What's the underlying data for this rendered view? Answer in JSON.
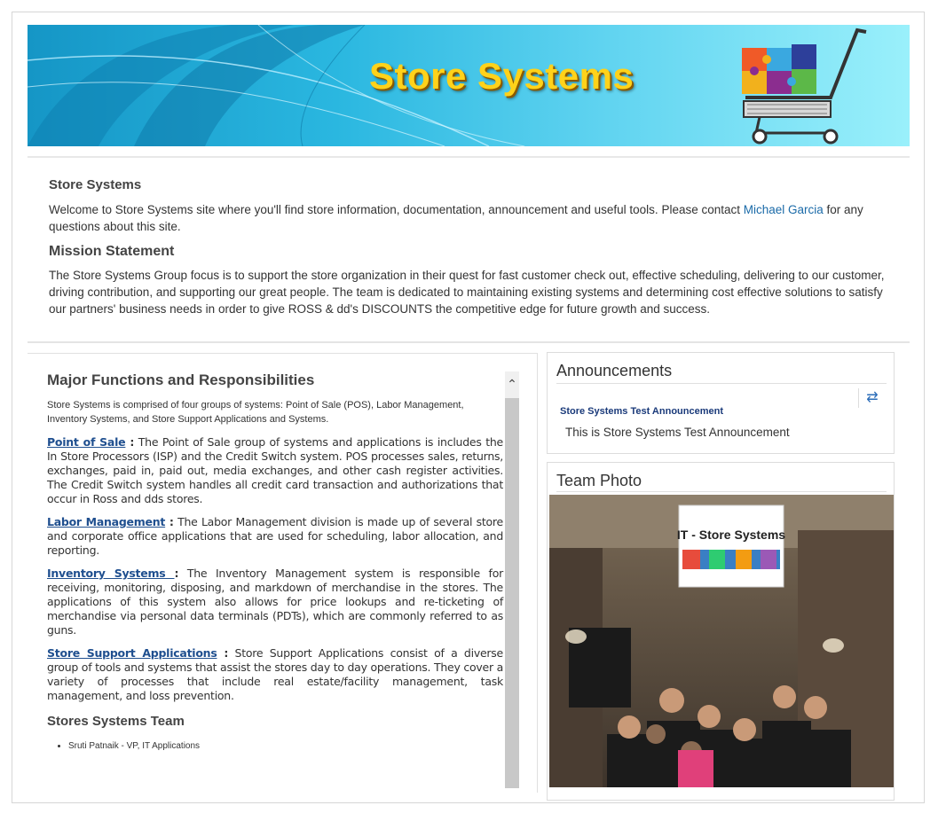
{
  "banner": {
    "title": "Store Systems"
  },
  "intro": {
    "heading": "Store Systems",
    "welcome_before": "Welcome to Store Systems site where you'll find store information, documentation, announcement and useful tools. Please contact ",
    "contact_name": "Michael Garcia",
    "welcome_after": " for any questions about this site."
  },
  "mission": {
    "heading": "Mission Statement",
    "text": "The Store Systems Group focus is to support the store organization in their quest for fast customer check out, effective scheduling, delivering to our customer, driving contribution, and supporting our great people. The team is dedicated to maintaining existing systems and determining cost effective solutions to satisfy our partners' business needs in order to give ROSS & dd's DISCOUNTS the competitive edge for future growth and success."
  },
  "functions": {
    "heading": "Major Functions and Responsibilities",
    "summary": "Store Systems is comprised of four groups of systems: Point of Sale (POS), Labor Management, Inventory Systems, and Store Support Applications and Systems.",
    "items": [
      {
        "label": "Point of Sale",
        "sep": " :",
        "text": " The Point of Sale group of systems and applications is includes the In Store Processors (ISP) and the Credit Switch system. POS processes sales, returns, exchanges, paid in, paid out, media exchanges, and other cash register activities. The Credit Switch system handles all credit card transaction and authorizations that occur in Ross and dds stores."
      },
      {
        "label": "Labor Management",
        "sep": " :",
        "text": " The Labor Management division is made up of several store and corporate office applications that are used for scheduling, labor allocation, and reporting."
      },
      {
        "label": "Inventory Systems ",
        "sep": " :",
        "text": " The Inventory Management system is responsible for receiving, monitoring, disposing, and markdown of merchandise in the stores. The applications of this system also allows for price lookups and re-ticketing of merchandise via personal data terminals (PDTs), which are commonly referred to as guns."
      },
      {
        "label": "Store Support Applications",
        "sep": " :",
        "text": " Store Support Applications consist of a diverse group of tools and systems that assist the stores day to day operations. They cover a variety of processes that include real estate/facility management, task management, and loss prevention."
      }
    ]
  },
  "team": {
    "heading": "Stores Systems Team",
    "members": [
      "Sruti Patnaik - VP, IT Applications"
    ]
  },
  "announcements": {
    "heading": "Announcements",
    "item_title": "Store Systems Test Announcement",
    "item_body": "This is Store Systems Test Announcement",
    "refresh_icon": "refresh-icon"
  },
  "team_photo": {
    "heading": "Team Photo",
    "banner_text": "IT - Store Systems"
  },
  "colors": {
    "link": "#1a6aa8",
    "banner_title": "#ffd21a",
    "announcement_title": "#1a3a7a"
  }
}
